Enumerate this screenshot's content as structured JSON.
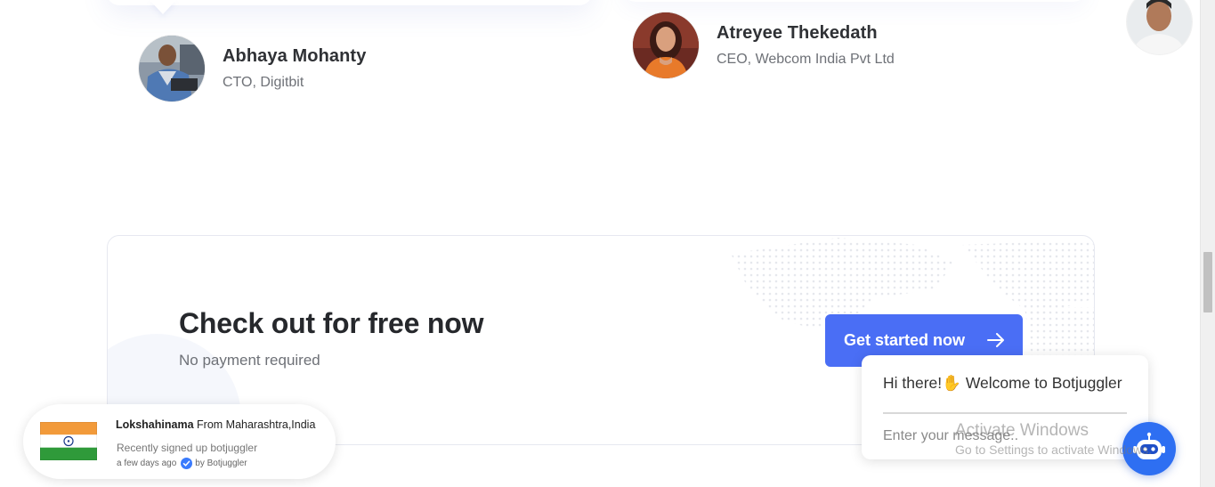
{
  "testimonials": [
    {
      "name": "Abhaya Mohanty",
      "role": "CTO, Digitbit"
    },
    {
      "name": "Atreyee Thekedath",
      "role": "CEO, Webcom India Pvt Ltd"
    }
  ],
  "cta": {
    "title": "Check out for free now",
    "subtitle": "No payment required",
    "button_label": "Get started now",
    "button_color": "#4a6ef5"
  },
  "notification": {
    "user": "Lokshahinama",
    "location": "From Maharashtra,India",
    "message": "Recently signed up botjuggler",
    "time": "a few days ago",
    "source": "by Botjuggler"
  },
  "chat": {
    "welcome_prefix": "Hi there!",
    "welcome_emoji": "✋",
    "welcome_suffix": "Welcome to Botjuggler",
    "input_placeholder": "Enter your message..",
    "fab_color": "#2e6ff2"
  },
  "watermark": {
    "title": "Activate Windows",
    "subtitle": "Go to Settings to activate Windows."
  }
}
